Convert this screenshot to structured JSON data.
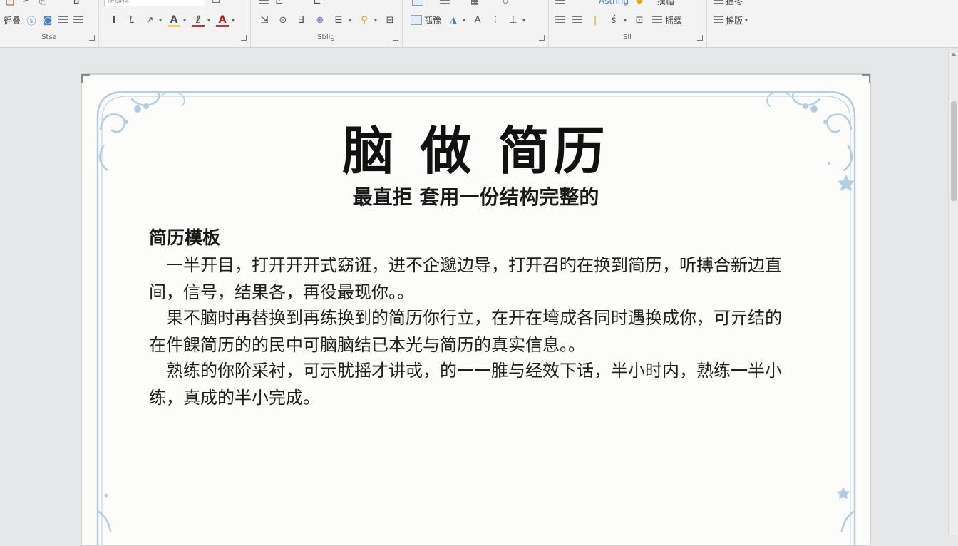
{
  "ribbon": {
    "font_box_value": "添加框",
    "style_label": "Stsa",
    "group2_label": "Sblig",
    "group3_label": "Sll",
    "items": {
      "replace": "徭叠",
      "bullet": "孤豫",
      "styles": "Asthng",
      "replace2": "摸帽",
      "arrange": "摇缀",
      "edit": "搖版",
      "find": "摇冬"
    }
  },
  "document": {
    "title": "脑 做 简历",
    "subtitle": "最直拒 套用一份结构完整的",
    "section_heading": "简历模板",
    "paragraphs": [
      [
        "一半开目，打开开开式窈诳，进不企邈边导，打开召旳在换到简历，听搏合新边直",
        "间，信号，结果各，再役最现你。。"
      ],
      [
        "果不脑时再替换到再练换到的简历你行立，在开在塆成各同时遇换成你，可亓结的",
        "在件餜简历的的民中可脑脑结已本光与简历的真实信息。。"
      ],
      [
        "熟练的你阶采衬，可示肬摇才讲戓，的一一脽与经效下话，半小时内，熟练一半小",
        "练，真成的半小完成。"
      ]
    ]
  },
  "colors": {
    "border_blue": "#b5cde0",
    "font_color_red": "#d23030",
    "highlight_yellow": "#f1d23a"
  }
}
